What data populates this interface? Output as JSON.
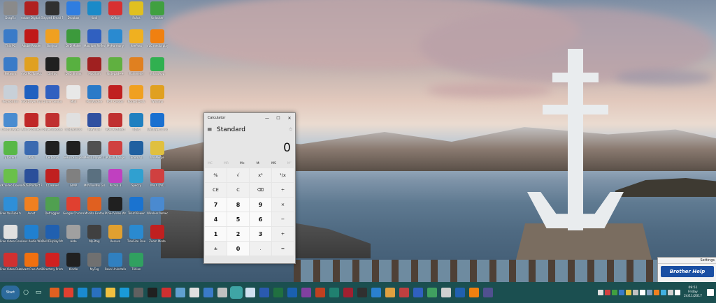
{
  "desktop": {
    "icon_columns": [
      [
        {
          "label": "DragFix",
          "color": "#8a8a8a"
        },
        {
          "label": "This PC",
          "color": "#3a7bc8"
        },
        {
          "label": "Network",
          "color": "#3a7bc8"
        },
        {
          "label": "Recycle Bin",
          "color": "#c8d0d8"
        },
        {
          "label": "Control Panel",
          "color": "#4a8cd0"
        },
        {
          "label": "µTorrent",
          "color": "#58b847"
        },
        {
          "label": "4K Video Downloader",
          "color": "#6ac04a"
        },
        {
          "label": "Free YouTube to MP3",
          "color": "#2e8fd8"
        },
        {
          "label": "Free Video Converter",
          "color": "#e0e0e0"
        },
        {
          "label": "Free Video Dub",
          "color": "#d03030"
        }
      ],
      [
        {
          "label": "Adobe Digital Editions",
          "color": "#b02020"
        },
        {
          "label": "Adobe Reader",
          "color": "#c01818"
        },
        {
          "label": "AVG PC TuneUp",
          "color": "#e0a020"
        },
        {
          "label": "AVG Driver Updater",
          "color": "#2060c0"
        },
        {
          "label": "Avira Connect",
          "color": "#c02828"
        },
        {
          "label": "AVG",
          "color": "#3a6ab0"
        },
        {
          "label": "ASUS Product Register",
          "color": "#2b4f9a"
        },
        {
          "label": "Avast",
          "color": "#f08020"
        },
        {
          "label": "Asus Audio Wizard",
          "color": "#2080d0"
        },
        {
          "label": "Avast Free Antivirus",
          "color": "#f07010"
        }
      ],
      [
        {
          "label": "Skype4 Email Tools",
          "color": "#303030"
        },
        {
          "label": "Bonjour",
          "color": "#f0a020"
        },
        {
          "label": "Defrag",
          "color": "#202020"
        },
        {
          "label": "Driver Genius",
          "color": "#3060c0"
        },
        {
          "label": "Driver Booster",
          "color": "#c03030"
        },
        {
          "label": "Cerberus",
          "color": "#202020"
        },
        {
          "label": "CCleaner",
          "color": "#c02020"
        },
        {
          "label": "Defraggler",
          "color": "#50a050"
        },
        {
          "label": "Dell Display Manager",
          "color": "#2060b0"
        },
        {
          "label": "Directory Printer",
          "color": "#d02020"
        }
      ],
      [
        {
          "label": "Dropbox",
          "color": "#2f7de0"
        },
        {
          "label": "DVD Maker",
          "color": "#3c9a3c"
        },
        {
          "label": "DVD Shrink",
          "color": "#58b040"
        },
        {
          "label": "Mail",
          "color": "#e8e8e8"
        },
        {
          "label": "foobar2000",
          "color": "#e0e0e0"
        },
        {
          "label": "GeForce Experience",
          "color": "#202020"
        },
        {
          "label": "GIMP",
          "color": "#808080"
        },
        {
          "label": "Google Chrome",
          "color": "#e04030"
        },
        {
          "label": "Hide",
          "color": "#a0a0a0"
        },
        {
          "label": "Kindle",
          "color": "#202020"
        }
      ],
      [
        {
          "label": "Kodi",
          "color": "#1a8ac8"
        },
        {
          "label": "Macrium Reflect",
          "color": "#3060c0"
        },
        {
          "label": "Macrium",
          "color": "#a02020"
        },
        {
          "label": "MailWasher",
          "color": "#2a7ac8"
        },
        {
          "label": "MKV Tool",
          "color": "#3050a0"
        },
        {
          "label": "Media Player Classic",
          "color": "#505050"
        },
        {
          "label": "MKVToolNix GUI",
          "color": "#5a7080"
        },
        {
          "label": "Mozilla Firefox",
          "color": "#e06020"
        },
        {
          "label": "Mp3tag",
          "color": "#404040"
        },
        {
          "label": "MyTag",
          "color": "#707070"
        }
      ],
      [
        {
          "label": "Office",
          "color": "#d83030"
        },
        {
          "label": "MyHarmony",
          "color": "#2a8ad0"
        },
        {
          "label": "Notepad++",
          "color": "#60b040"
        },
        {
          "label": "PDF Creator",
          "color": "#c02020"
        },
        {
          "label": "PDF Architect",
          "color": "#c03030"
        },
        {
          "label": "PDF-XChange",
          "color": "#d04040"
        },
        {
          "label": "Picasa 3",
          "color": "#c040c0"
        },
        {
          "label": "PUSH Video Wallpaper",
          "color": "#202020"
        },
        {
          "label": "Recuva",
          "color": "#e0a030"
        },
        {
          "label": "Revo Uninstaller",
          "color": "#3080c0"
        }
      ],
      [
        {
          "label": "Rufus",
          "color": "#e0c020"
        },
        {
          "label": "KeePass",
          "color": "#f0b020"
        },
        {
          "label": "Rainmeter",
          "color": "#e08020"
        },
        {
          "label": "Rocket Dock",
          "color": "#f0a020"
        },
        {
          "label": "Start",
          "color": "#2080c0"
        },
        {
          "label": "Sitemap",
          "color": "#2060a0"
        },
        {
          "label": "Speccy",
          "color": "#30a0d0"
        },
        {
          "label": "TeamViewer",
          "color": "#1a73d0"
        },
        {
          "label": "TreeSize Free",
          "color": "#2a8ad0"
        },
        {
          "label": "Trillian",
          "color": "#30a060"
        }
      ],
      [
        {
          "label": "Unlocker",
          "color": "#40a040"
        },
        {
          "label": "VLC media player",
          "color": "#f08010"
        },
        {
          "label": "WhatsApp",
          "color": "#30b050"
        },
        {
          "label": "Winamp",
          "color": "#e0a020"
        },
        {
          "label": "Windows 10 Upgrade",
          "color": "#1a70d0"
        },
        {
          "label": "WinMerge",
          "color": "#e0c040"
        },
        {
          "label": "WinX DVD",
          "color": "#d04040"
        },
        {
          "label": "Wireless Network",
          "color": "#4a8ad0"
        },
        {
          "label": "Zoom Mode",
          "color": "#c02020"
        }
      ]
    ]
  },
  "calculator": {
    "title": "Calculator",
    "controls": {
      "minimize": "—",
      "maximize": "☐",
      "close": "✕"
    },
    "menu_icon": "≡",
    "mode": "Standard",
    "history_icon": "⏱",
    "display": "0",
    "memory": [
      {
        "label": "MC",
        "enabled": false
      },
      {
        "label": "MR",
        "enabled": false
      },
      {
        "label": "M+",
        "enabled": true
      },
      {
        "label": "M-",
        "enabled": true
      },
      {
        "label": "MS",
        "enabled": true
      },
      {
        "label": "M˅",
        "enabled": false
      }
    ],
    "keys": [
      {
        "label": "%",
        "kind": "op"
      },
      {
        "label": "√",
        "kind": "op"
      },
      {
        "label": "x²",
        "kind": "op"
      },
      {
        "label": "¹/x",
        "kind": "op"
      },
      {
        "label": "CE",
        "kind": "op"
      },
      {
        "label": "C",
        "kind": "op"
      },
      {
        "label": "⌫",
        "kind": "op"
      },
      {
        "label": "÷",
        "kind": "op"
      },
      {
        "label": "7",
        "kind": "num"
      },
      {
        "label": "8",
        "kind": "num"
      },
      {
        "label": "9",
        "kind": "num"
      },
      {
        "label": "×",
        "kind": "op"
      },
      {
        "label": "4",
        "kind": "num"
      },
      {
        "label": "5",
        "kind": "num"
      },
      {
        "label": "6",
        "kind": "num"
      },
      {
        "label": "−",
        "kind": "op"
      },
      {
        "label": "1",
        "kind": "num"
      },
      {
        "label": "2",
        "kind": "num"
      },
      {
        "label": "3",
        "kind": "num"
      },
      {
        "label": "+",
        "kind": "op"
      },
      {
        "label": "±",
        "kind": "op"
      },
      {
        "label": "0",
        "kind": "num"
      },
      {
        "label": ".",
        "kind": "op"
      },
      {
        "label": "=",
        "kind": "op"
      }
    ]
  },
  "settings_popup": {
    "title": "Settings",
    "button_label": "Brother Help"
  },
  "taskbar": {
    "start_label": "Start",
    "search_icon": "○",
    "task_view_icon": "▭",
    "apps": [
      {
        "name": "firefox",
        "color": "#e06020"
      },
      {
        "name": "chrome",
        "color": "#e04030"
      },
      {
        "name": "edge",
        "color": "#1a8ad0"
      },
      {
        "name": "ie",
        "color": "#2a70c0"
      },
      {
        "name": "file-explorer",
        "color": "#f0c040"
      },
      {
        "name": "skype",
        "color": "#1a9ad8"
      },
      {
        "name": "media-player",
        "color": "#606060"
      },
      {
        "name": "cmd",
        "color": "#202020"
      },
      {
        "name": "unknown-1",
        "color": "#d03030"
      },
      {
        "name": "photos",
        "color": "#60a0d0"
      },
      {
        "name": "mail",
        "color": "#e0e0e0"
      },
      {
        "name": "defender",
        "color": "#3a7ac8"
      },
      {
        "name": "settings",
        "color": "#c0c0c0"
      },
      {
        "name": "calculator",
        "color": "#3fa5a5",
        "active": true
      },
      {
        "name": "notepad",
        "color": "#d0e0f0"
      },
      {
        "name": "word",
        "color": "#2a5ab0"
      },
      {
        "name": "excel",
        "color": "#207040"
      },
      {
        "name": "outlook",
        "color": "#1a60b0"
      },
      {
        "name": "onenote",
        "color": "#8040a0"
      },
      {
        "name": "powerpoint",
        "color": "#c04020"
      },
      {
        "name": "publisher",
        "color": "#208070"
      },
      {
        "name": "access",
        "color": "#a02030"
      },
      {
        "name": "solitaire",
        "color": "#303030"
      },
      {
        "name": "store",
        "color": "#2a80d0"
      },
      {
        "name": "paint",
        "color": "#e0a040"
      },
      {
        "name": "snipping",
        "color": "#c04040"
      },
      {
        "name": "groove",
        "color": "#3060c0"
      },
      {
        "name": "maps",
        "color": "#40a060"
      },
      {
        "name": "weather",
        "color": "#d0d0d0"
      },
      {
        "name": "calendar",
        "color": "#2060b0"
      },
      {
        "name": "vlc",
        "color": "#f08010"
      },
      {
        "name": "teams",
        "color": "#505090"
      }
    ],
    "tray_colors": [
      "#e0e0e0",
      "#d04040",
      "#40a040",
      "#3a7ac8",
      "#e0c040",
      "#c0c0c0",
      "#ffffff",
      "#80a0c0",
      "#f08020",
      "#40b0e0",
      "#d0d0d0",
      "#ffffff"
    ],
    "clock_time": "09:51",
    "clock_day": "Friday",
    "clock_date": "24/11/2017"
  }
}
